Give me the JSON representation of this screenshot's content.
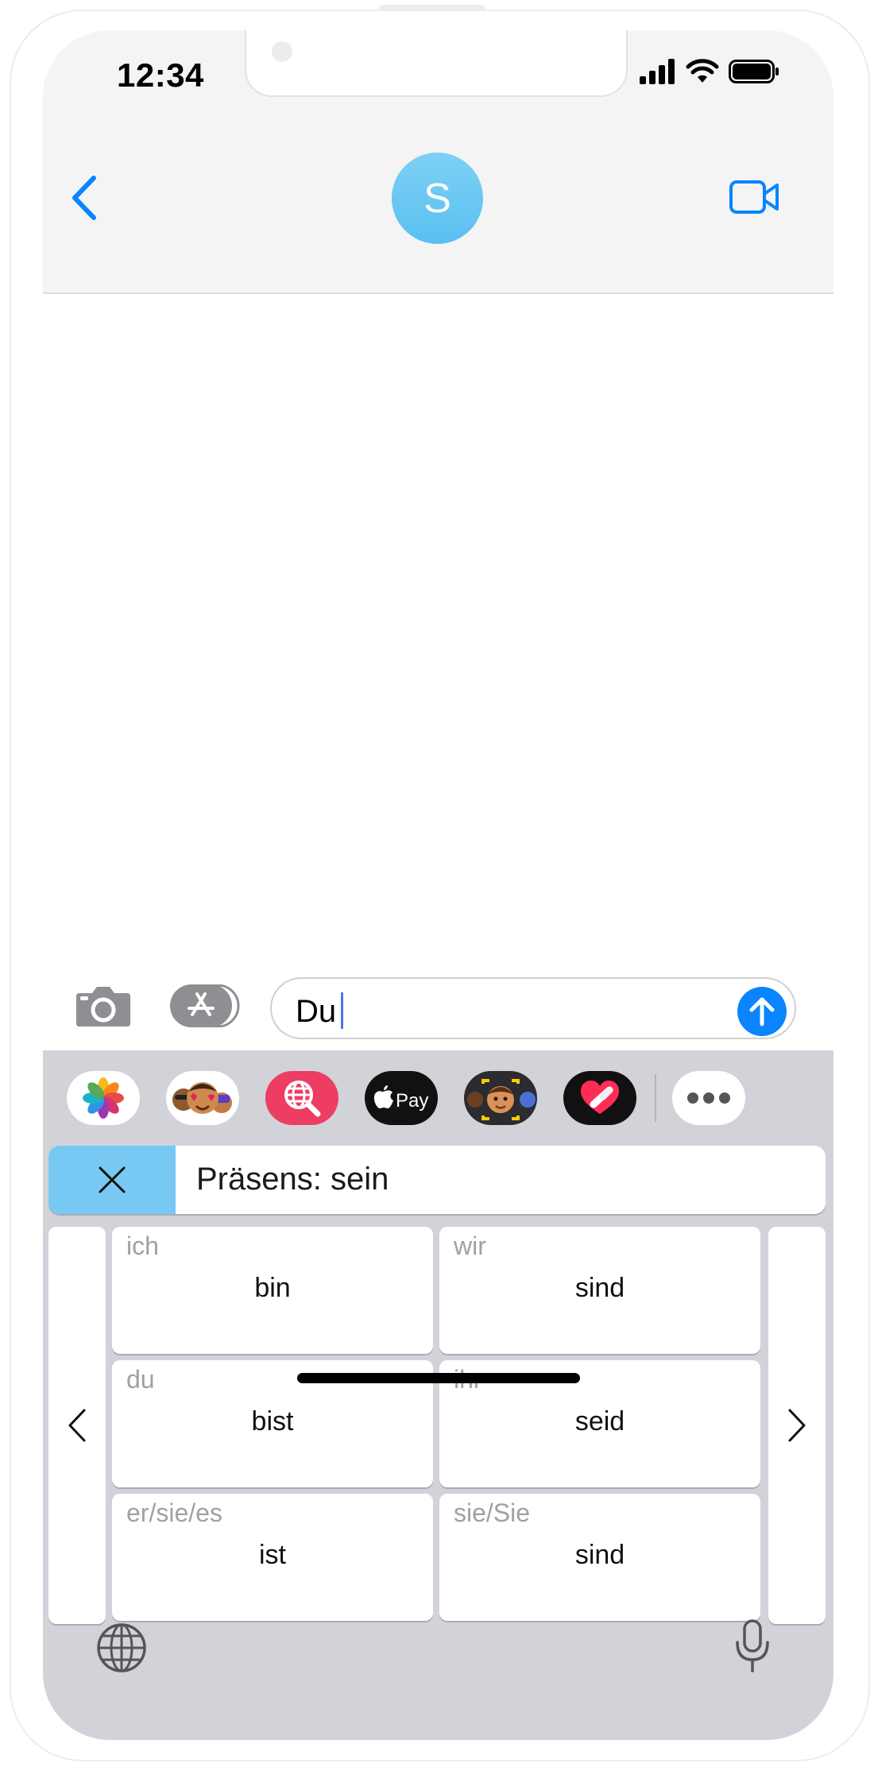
{
  "status_bar": {
    "time": "12:34"
  },
  "conversation": {
    "contact_initial": "S"
  },
  "composer": {
    "text": "Du"
  },
  "app_drawer": {
    "apps": [
      {
        "id": "photos",
        "icon": "photos-icon"
      },
      {
        "id": "memoji-stickers",
        "icon": "memoji-stickers-icon"
      },
      {
        "id": "web-search",
        "icon": "globe-search-icon"
      },
      {
        "id": "apple-pay",
        "icon": "apple-pay-icon"
      },
      {
        "id": "animoji",
        "icon": "animoji-icon"
      },
      {
        "id": "digital-touch",
        "icon": "digital-touch-icon"
      },
      {
        "id": "more",
        "icon": "more-icon"
      }
    ]
  },
  "keyboard": {
    "title": "Präsens: sein",
    "conjugations": [
      {
        "pronoun": "ich",
        "form": "bin"
      },
      {
        "pronoun": "wir",
        "form": "sind"
      },
      {
        "pronoun": "du",
        "form": "bist"
      },
      {
        "pronoun": "ihr",
        "form": "seid"
      },
      {
        "pronoun": "er/sie/es",
        "form": "ist"
      },
      {
        "pronoun": "sie/Sie",
        "form": "sind"
      }
    ]
  },
  "colors": {
    "accent": "#0a84ff",
    "avatar": "#6ac6f3",
    "keyboard_close_bg": "#77c8f2",
    "keyboard_bg": "#d1d3d9",
    "nav_bg": "#f4f4f5",
    "pronoun_text": "#a0a0a6"
  }
}
